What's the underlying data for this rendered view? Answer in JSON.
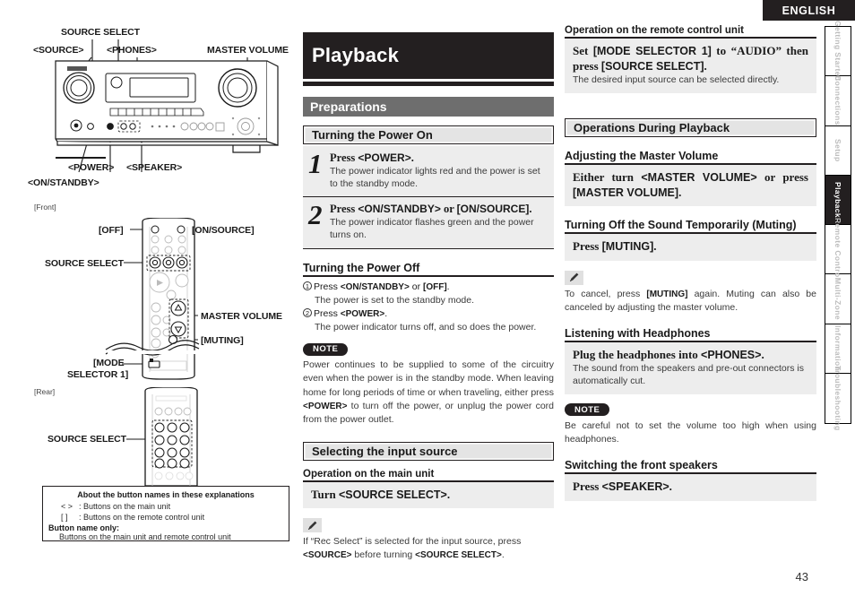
{
  "header": {
    "language": "ENGLISH"
  },
  "page": {
    "number": "43"
  },
  "tab_rail": {
    "items": [
      {
        "label": "Getting Started",
        "active": false
      },
      {
        "label": "Connections",
        "active": false
      },
      {
        "label": "Setup",
        "active": false
      },
      {
        "label": "Playback",
        "active": true
      },
      {
        "label": "Remote Control",
        "active": false
      },
      {
        "label": "Multi-Zone",
        "active": false
      },
      {
        "label": "Information",
        "active": false
      },
      {
        "label": "Troubleshooting",
        "active": false
      }
    ]
  },
  "diagrams": {
    "front_caption": "[Front]",
    "rear_caption": "[Rear]",
    "main_unit_labels": {
      "source_select": "SOURCE SELECT",
      "source": "<SOURCE>",
      "phones": "<PHONES>",
      "master_volume": "MASTER VOLUME",
      "power": "<POWER>",
      "speaker": "<SPEAKER>",
      "on_standby": "<ON/STANDBY>"
    },
    "remote_front_labels": {
      "off": "[OFF]",
      "on_source": "[ON/SOURCE]",
      "source_select": "SOURCE SELECT",
      "master_volume": "MASTER VOLUME",
      "muting": "[MUTING]",
      "mode_selector_line1": "[MODE",
      "mode_selector_line2": "SELECTOR 1]"
    },
    "remote_rear_labels": {
      "source_select": "SOURCE SELECT"
    }
  },
  "about_box": {
    "title": "About the button names in these explanations",
    "rows": [
      {
        "symbol": "<  >",
        "text": ": Buttons on the main unit"
      },
      {
        "symbol": "[   ]",
        "text": ": Buttons on the remote control unit"
      }
    ],
    "only_label": "Button name only:",
    "only_text": "Buttons on the main unit and remote control unit"
  },
  "chapter": {
    "title": "Playback"
  },
  "middle": {
    "section": "Preparations",
    "power_on": {
      "heading": "Turning the Power On",
      "steps": [
        {
          "num": "1",
          "head_pre": "Press ",
          "head_key": "<POWER>",
          "head_post": ".",
          "desc": "The power indicator lights red and the power is set to the standby mode."
        },
        {
          "num": "2",
          "head_pre": "Press ",
          "head_key": "<ON/STANDBY>",
          "head_mid": " or ",
          "head_key2": "[ON/SOURCE]",
          "head_post": ".",
          "desc": "The power indicator flashes green and the power turns on."
        }
      ]
    },
    "power_off": {
      "heading": "Turning the Power Off",
      "items": [
        {
          "n": "1",
          "pre": "Press ",
          "key": "<ON/STANDBY>",
          "mid": " or ",
          "key2": "[OFF]",
          "post": ".",
          "sub": "The power is set to the standby mode."
        },
        {
          "n": "2",
          "pre": "Press ",
          "key": "<POWER>",
          "mid": "",
          "key2": "",
          "post": ".",
          "sub": "The power indicator turns off, and so does the power."
        }
      ],
      "note_badge": "NOTE",
      "note_pre": "Power continues to be supplied to some of the circuitry even when the power is in the standby mode. When leaving home for long periods of time or when traveling, either press ",
      "note_key": "<POWER>",
      "note_post": " to turn off the power, or unplug the power cord from the power outlet."
    },
    "input_source": {
      "heading": "Selecting the input source",
      "main_unit_heading": "Operation on the main unit",
      "instr_pre": "Turn ",
      "instr_key": "<SOURCE SELECT>",
      "instr_post": ".",
      "tip_pre": "If “Rec Select” is selected for the input source, press ",
      "tip_key": "<SOURCE>",
      "tip_mid": " before turning ",
      "tip_key2": "<SOURCE SELECT>",
      "tip_post": "."
    }
  },
  "right": {
    "remote_unit": {
      "heading": "Operation on the remote control unit",
      "instr_pre": "Set ",
      "instr_key": "[MODE SELECTOR 1]",
      "instr_mid": " to “AUDIO” then press ",
      "instr_key2": "[SOURCE SELECT]",
      "instr_post": ".",
      "desc": "The desired input source can be selected directly."
    },
    "section": "Operations During Playback",
    "master_volume": {
      "heading": "Adjusting the Master Volume",
      "instr_pre": "Either turn ",
      "instr_key": "<MASTER VOLUME>",
      "instr_mid": " or press ",
      "instr_key2": "[MASTER VOLUME]",
      "instr_post": "."
    },
    "muting": {
      "heading": "Turning Off the Sound Temporarily (Muting)",
      "instr_pre": "Press ",
      "instr_key": "[MUTING]",
      "instr_post": ".",
      "tip_pre": "To cancel, press ",
      "tip_key": "[MUTING]",
      "tip_post": " again. Muting can also be canceled by adjusting the master volume."
    },
    "headphones": {
      "heading": "Listening with Headphones",
      "instr_pre": "Plug the headphones into ",
      "instr_key": "<PHONES>",
      "instr_post": ".",
      "desc": "The sound from the speakers and pre-out connectors is automatically cut.",
      "note_badge": "NOTE",
      "note_text": "Be careful not to set the volume too high when using headphones."
    },
    "front_speakers": {
      "heading": "Switching the front speakers",
      "instr_pre": "Press ",
      "instr_key": "<SPEAKER>",
      "instr_post": "."
    }
  },
  "colors": {
    "ink": "#231f20",
    "section_grey": "#6e6e6e",
    "panel_grey": "#ededed",
    "subsec_grey": "#e4e4e4"
  }
}
